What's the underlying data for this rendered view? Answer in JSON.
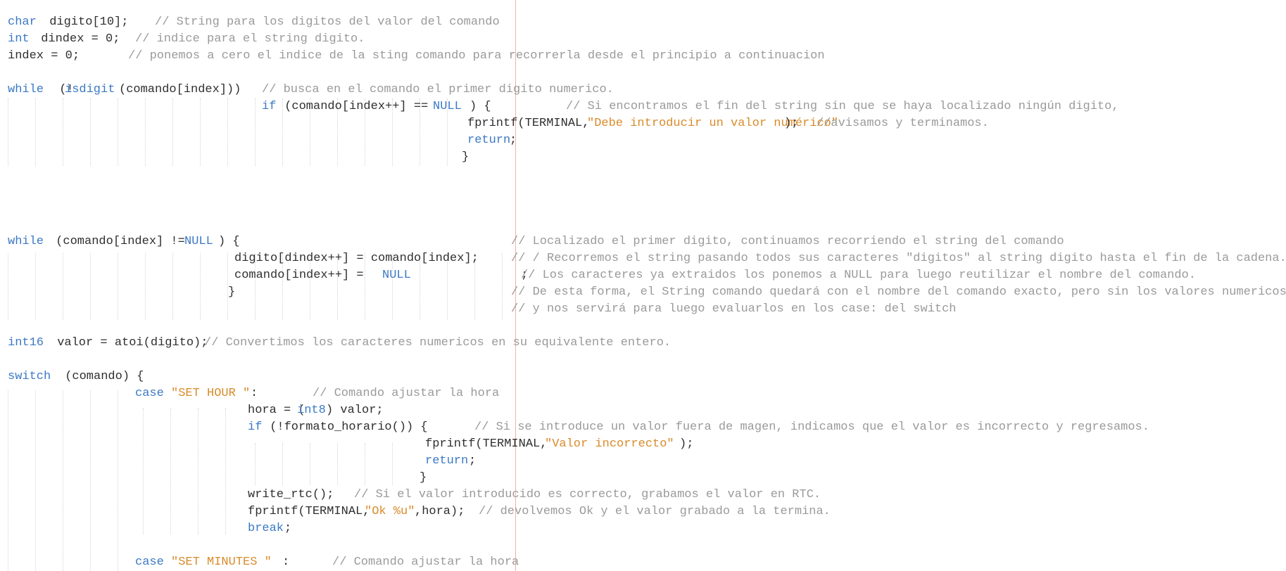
{
  "colors": {
    "keyword": "#3b79c4",
    "string": "#d98b2b",
    "comment": "#9a9a9a",
    "text": "#2f2f2f",
    "guide": "#d4d4d4",
    "margin_line": "#f2b0aa",
    "background": "#ffffff"
  },
  "code": [
    {
      "tokens": [
        {
          "t": "char",
          "c": "type"
        },
        {
          "t": " digito[10];",
          "c": "plain"
        },
        {
          "t": "// String para los digitos del valor del comando",
          "c": "cmt"
        }
      ]
    },
    {
      "tokens": [
        {
          "t": "int",
          "c": "type"
        },
        {
          "t": " dindex = 0;",
          "c": "plain"
        },
        {
          "t": "// indice para el string digito.",
          "c": "cmt"
        }
      ]
    },
    {
      "tokens": [
        {
          "t": "index = 0;",
          "c": "plain"
        },
        {
          "t": "// ponemos a cero el indice de la sting comando para recorrerla desde el principio a continuacion",
          "c": "cmt"
        }
      ]
    },
    {
      "tokens": []
    },
    {
      "tokens": [
        {
          "t": "while",
          "c": "kw"
        },
        {
          "t": " (!",
          "c": "plain"
        },
        {
          "t": "isdigit",
          "c": "fn"
        },
        {
          "t": "(comando[index]))",
          "c": "plain"
        },
        {
          "t": "// busca en el comando el primer digito numerico.",
          "c": "cmt"
        }
      ]
    },
    {
      "tokens": [
        {
          "t": "if",
          "c": "kw"
        },
        {
          "t": " (comando[index++] == ",
          "c": "plain"
        },
        {
          "t": "NULL",
          "c": "const"
        },
        {
          "t": ") {",
          "c": "plain"
        },
        {
          "t": "// Si encontramos el fin del string sin que se haya localizado ningún digito,",
          "c": "cmt"
        }
      ]
    },
    {
      "tokens": [
        {
          "t": "fprintf(TERMINAL,",
          "c": "plain"
        },
        {
          "t": "\"Debe introducir un valor numérico\"",
          "c": "str"
        },
        {
          "t": "); ",
          "c": "plain"
        },
        {
          "t": "//avisamos y terminamos.",
          "c": "cmt"
        }
      ]
    },
    {
      "tokens": [
        {
          "t": "return",
          "c": "kw"
        },
        {
          "t": ";",
          "c": "plain"
        }
      ]
    },
    {
      "tokens": [
        {
          "t": "}",
          "c": "plain"
        }
      ]
    },
    {
      "tokens": []
    },
    {
      "tokens": []
    },
    {
      "tokens": []
    },
    {
      "tokens": []
    },
    {
      "tokens": [
        {
          "t": "while",
          "c": "kw"
        },
        {
          "t": " (comando[index] != ",
          "c": "plain"
        },
        {
          "t": "NULL",
          "c": "const"
        },
        {
          "t": ") {",
          "c": "plain"
        },
        {
          "t": "// Localizado el primer digito, continuamos recorriendo el string del comando",
          "c": "cmt"
        }
      ]
    },
    {
      "tokens": [
        {
          "t": "digito[dindex++] = comando[index];",
          "c": "plain"
        },
        {
          "t": "// / Recorremos el string pasando todos sus caracteres \"digitos\" al string digito hasta el fin de la cadena.",
          "c": "cmt"
        }
      ]
    },
    {
      "tokens": [
        {
          "t": "comando[index++] = ",
          "c": "plain"
        },
        {
          "t": "NULL",
          "c": "const"
        },
        {
          "t": ";",
          "c": "plain"
        },
        {
          "t": "// Los caracteres ya extraidos los ponemos a NULL para luego reutilizar el nombre del comando.",
          "c": "cmt"
        }
      ]
    },
    {
      "tokens": [
        {
          "t": "}",
          "c": "plain"
        },
        {
          "t": "// De esta forma, el String comando quedará con el nombre del comando exacto, pero sin los valores numericos.",
          "c": "cmt"
        }
      ]
    },
    {
      "tokens": [
        {
          "t": "// y nos servirá para luego evaluarlos en los case: del switch",
          "c": "cmt"
        }
      ]
    },
    {
      "tokens": []
    },
    {
      "tokens": [
        {
          "t": "int16",
          "c": "type"
        },
        {
          "t": " valor = atoi(digito); ",
          "c": "plain"
        },
        {
          "t": "// Convertimos los caracteres numericos en su equivalente entero.",
          "c": "cmt"
        }
      ]
    },
    {
      "tokens": []
    },
    {
      "tokens": [
        {
          "t": "switch",
          "c": "kw"
        },
        {
          "t": " (comando) {",
          "c": "plain"
        }
      ]
    },
    {
      "tokens": [
        {
          "t": "case",
          "c": "kw"
        },
        {
          "t": " ",
          "c": "plain"
        },
        {
          "t": "\"SET HOUR \"",
          "c": "str"
        },
        {
          "t": ":",
          "c": "plain"
        },
        {
          "t": "// Comando ajustar la hora",
          "c": "cmt"
        }
      ]
    },
    {
      "tokens": [
        {
          "t": "hora = (",
          "c": "plain"
        },
        {
          "t": "int8",
          "c": "type"
        },
        {
          "t": ") valor;",
          "c": "plain"
        }
      ]
    },
    {
      "tokens": [
        {
          "t": "if",
          "c": "kw"
        },
        {
          "t": " (!formato_horario()) {",
          "c": "plain"
        },
        {
          "t": "// Si se introduce un valor fuera de magen, indicamos que el valor es incorrecto y regresamos.",
          "c": "cmt"
        }
      ]
    },
    {
      "tokens": [
        {
          "t": "fprintf(TERMINAL,",
          "c": "plain"
        },
        {
          "t": "\"Valor incorrecto\"",
          "c": "str"
        },
        {
          "t": ");",
          "c": "plain"
        }
      ]
    },
    {
      "tokens": [
        {
          "t": "return",
          "c": "kw"
        },
        {
          "t": ";",
          "c": "plain"
        }
      ]
    },
    {
      "tokens": [
        {
          "t": "}",
          "c": "plain"
        }
      ]
    },
    {
      "tokens": [
        {
          "t": "write_rtc();",
          "c": "plain"
        },
        {
          "t": "// Si el valor introducido es correcto, grabamos el valor en RTC.",
          "c": "cmt"
        }
      ]
    },
    {
      "tokens": [
        {
          "t": "fprintf(TERMINAL,",
          "c": "plain"
        },
        {
          "t": "\"Ok %u\"",
          "c": "str"
        },
        {
          "t": ",hora); ",
          "c": "plain"
        },
        {
          "t": "// devolvemos Ok y el valor grabado a la termina.",
          "c": "cmt"
        }
      ]
    },
    {
      "tokens": [
        {
          "t": "break",
          "c": "kw"
        },
        {
          "t": ";",
          "c": "plain"
        }
      ]
    },
    {
      "tokens": []
    },
    {
      "tokens": [
        {
          "t": "case",
          "c": "kw"
        },
        {
          "t": " ",
          "c": "plain"
        },
        {
          "t": "\"SET MINUTES \"",
          "c": "str"
        },
        {
          "t": ":",
          "c": "plain"
        },
        {
          "t": "// Comando ajustar la hora",
          "c": "cmt"
        }
      ]
    }
  ]
}
